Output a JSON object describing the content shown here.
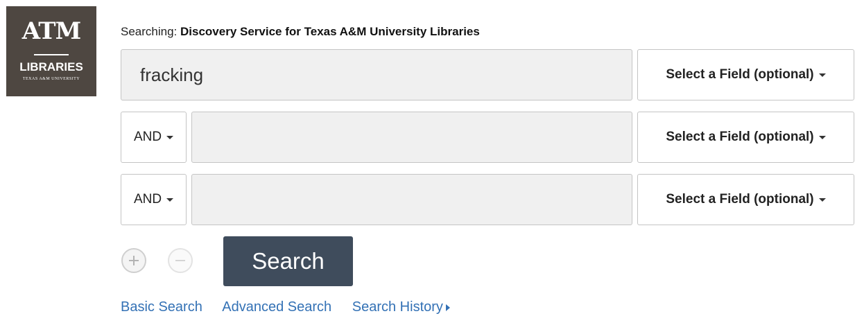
{
  "logo": {
    "mark": "ATM",
    "title": "LIBRARIES",
    "subtitle": "TEXAS A&M UNIVERSITY"
  },
  "searching": {
    "prefix": "Searching:",
    "target": "Discovery Service for Texas A&M University Libraries"
  },
  "rows": [
    {
      "value": "fracking",
      "field": "Select a Field (optional)"
    },
    {
      "operator": "AND",
      "value": "",
      "field": "Select a Field (optional)"
    },
    {
      "operator": "AND",
      "value": "",
      "field": "Select a Field (optional)"
    }
  ],
  "search_button": "Search",
  "links": {
    "basic": "Basic Search",
    "advanced": "Advanced Search",
    "history": "Search History"
  },
  "colors": {
    "logo_bg": "#4e4741",
    "button_bg": "#3f4c5c",
    "link": "#3371b5",
    "input_bg": "#f0f0f0"
  }
}
